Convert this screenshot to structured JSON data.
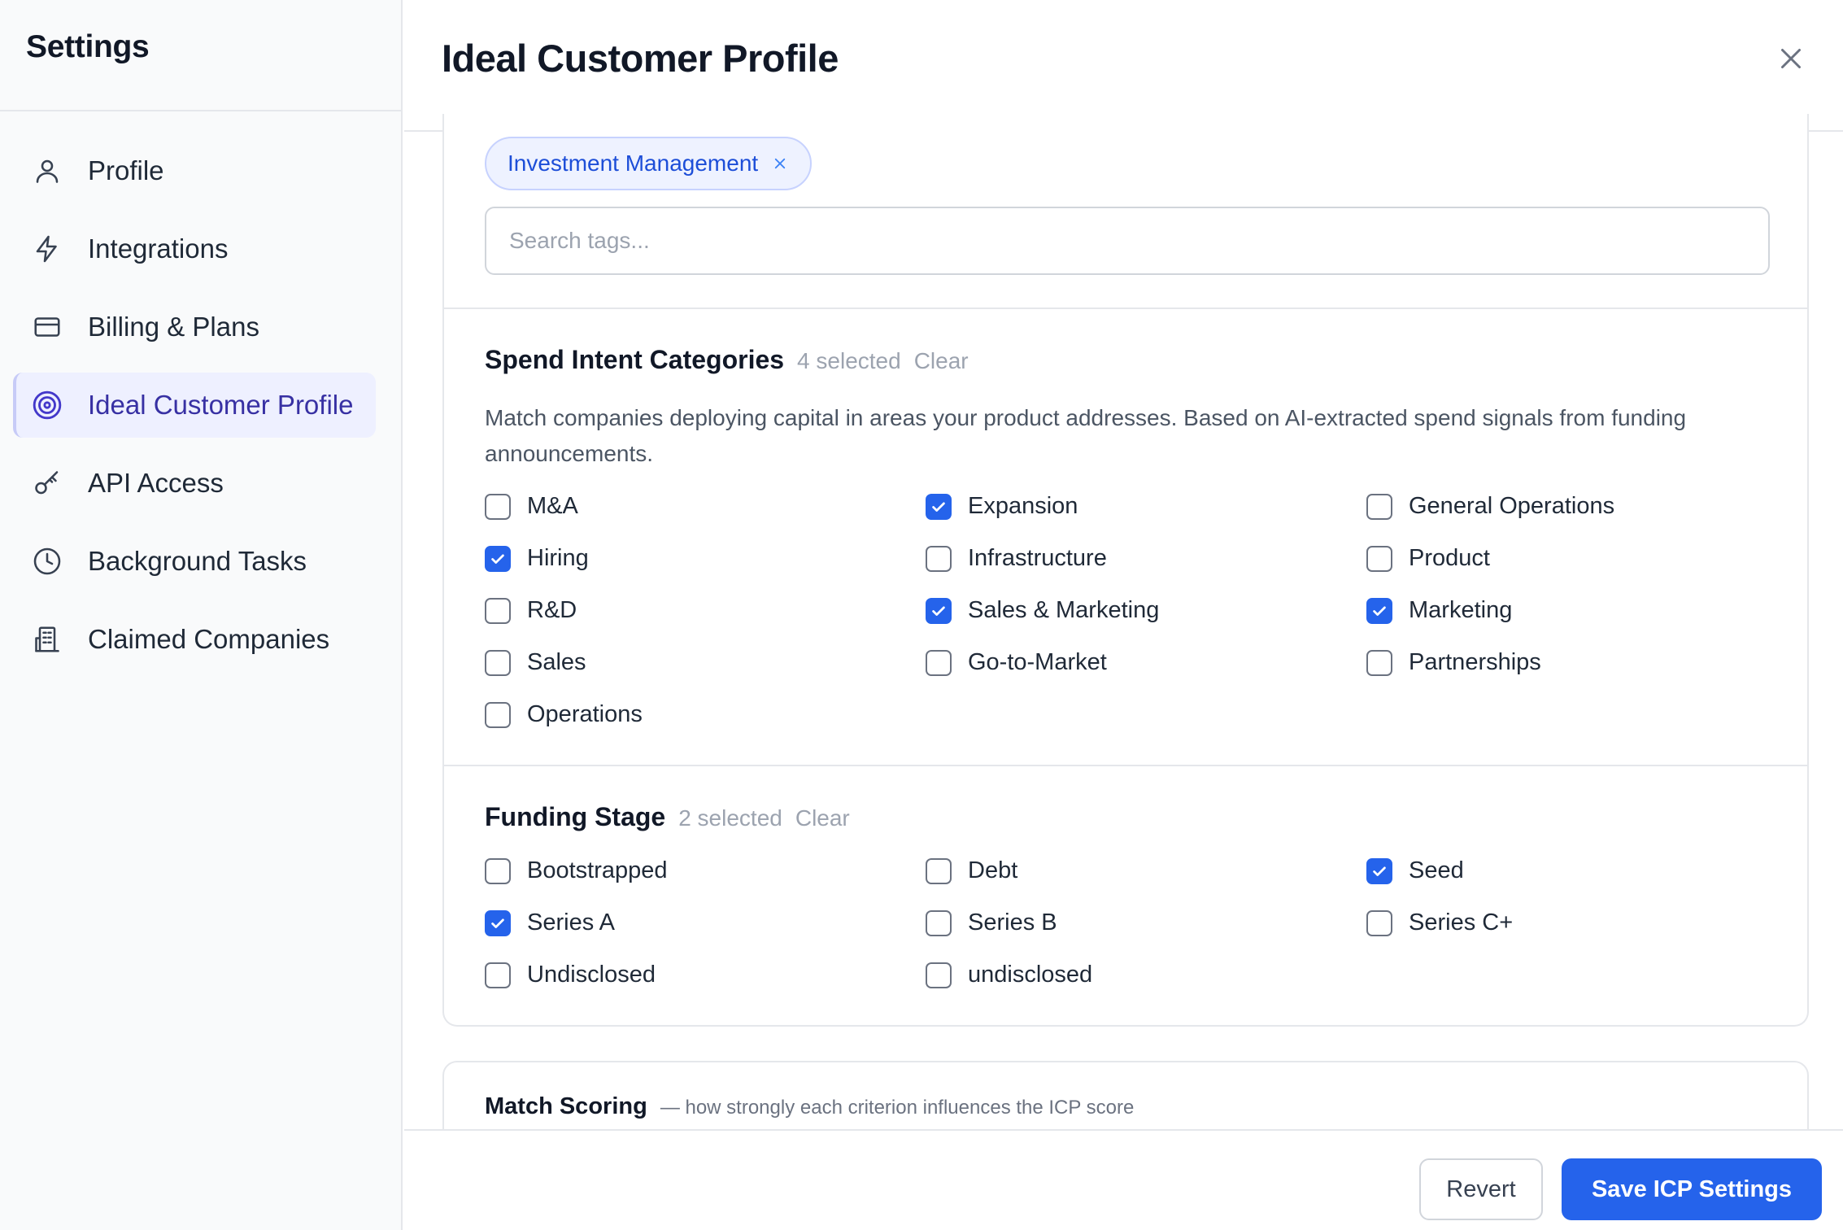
{
  "sidebar": {
    "title": "Settings",
    "items": [
      {
        "label": "Profile",
        "icon": "user-icon"
      },
      {
        "label": "Integrations",
        "icon": "lightning-icon"
      },
      {
        "label": "Billing & Plans",
        "icon": "credit-card-icon"
      },
      {
        "label": "Ideal Customer Profile",
        "icon": "target-icon",
        "active": true
      },
      {
        "label": "API Access",
        "icon": "key-icon"
      },
      {
        "label": "Background Tasks",
        "icon": "clock-icon"
      },
      {
        "label": "Claimed Companies",
        "icon": "building-icon"
      }
    ]
  },
  "header": {
    "title": "Ideal Customer Profile",
    "close_icon": "close-icon"
  },
  "tags": {
    "selected": [
      {
        "label": "Investment Management"
      }
    ],
    "search_placeholder": "Search tags..."
  },
  "spend_intent": {
    "title": "Spend Intent Categories",
    "count": "4 selected",
    "clear": "Clear",
    "description": "Match companies deploying capital in areas your product addresses. Based on AI-extracted spend signals from funding announcements.",
    "options": [
      {
        "label": "M&A",
        "checked": false
      },
      {
        "label": "Expansion",
        "checked": true
      },
      {
        "label": "General Operations",
        "checked": false
      },
      {
        "label": "Hiring",
        "checked": true
      },
      {
        "label": "Infrastructure",
        "checked": false
      },
      {
        "label": "Product",
        "checked": false
      },
      {
        "label": "R&D",
        "checked": false
      },
      {
        "label": "Sales & Marketing",
        "checked": true
      },
      {
        "label": "Marketing",
        "checked": true
      },
      {
        "label": "Sales",
        "checked": false
      },
      {
        "label": "Go-to-Market",
        "checked": false
      },
      {
        "label": "Partnerships",
        "checked": false
      },
      {
        "label": "Operations",
        "checked": false
      }
    ]
  },
  "funding_stage": {
    "title": "Funding Stage",
    "count": "2 selected",
    "clear": "Clear",
    "options": [
      {
        "label": "Bootstrapped",
        "checked": false
      },
      {
        "label": "Debt",
        "checked": false
      },
      {
        "label": "Seed",
        "checked": true
      },
      {
        "label": "Series A",
        "checked": true
      },
      {
        "label": "Series B",
        "checked": false
      },
      {
        "label": "Series C+",
        "checked": false
      },
      {
        "label": "Undisclosed",
        "checked": false
      },
      {
        "label": "undisclosed",
        "checked": false
      }
    ]
  },
  "match_scoring": {
    "title": "Match Scoring",
    "subtitle": "— how strongly each criterion influences the ICP score"
  },
  "footer": {
    "revert_label": "Revert",
    "save_label": "Save ICP Settings"
  },
  "colors": {
    "accent": "#2563eb",
    "active_nav_bg": "#eef0ff",
    "active_nav_text": "#3730a3",
    "chip_bg": "#eef2ff",
    "chip_text": "#1d4ed8"
  }
}
